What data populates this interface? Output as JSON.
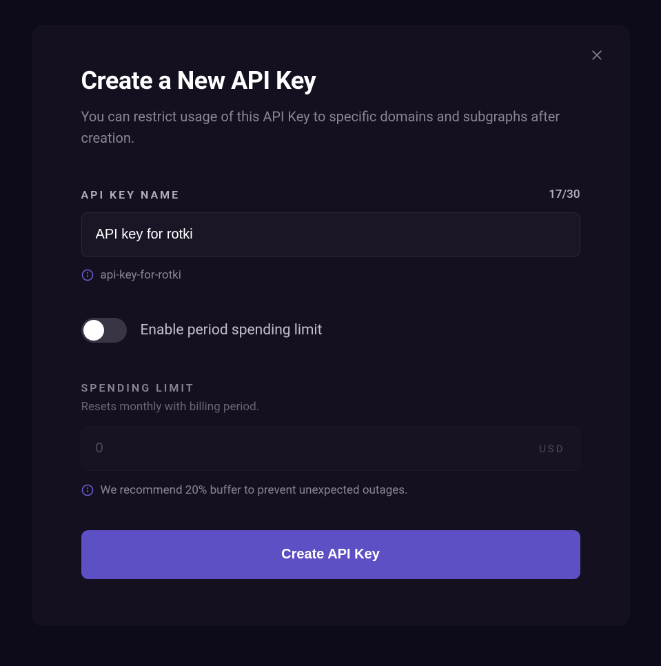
{
  "modal": {
    "title": "Create a New API Key",
    "subtitle": "You can restrict usage of this API Key to specific domains and subgraphs after creation.",
    "api_key_name": {
      "label": "API KEY NAME",
      "char_count": "17/30",
      "value": "API key for rotki",
      "slug": "api-key-for-rotki"
    },
    "spending_toggle": {
      "label": "Enable period spending limit",
      "enabled": false
    },
    "spending_limit": {
      "label": "SPENDING LIMIT",
      "description": "Resets monthly with billing period.",
      "value": "0",
      "currency": "USD",
      "recommendation": "We recommend 20% buffer to prevent unexpected outages."
    },
    "create_button": "Create API Key"
  }
}
